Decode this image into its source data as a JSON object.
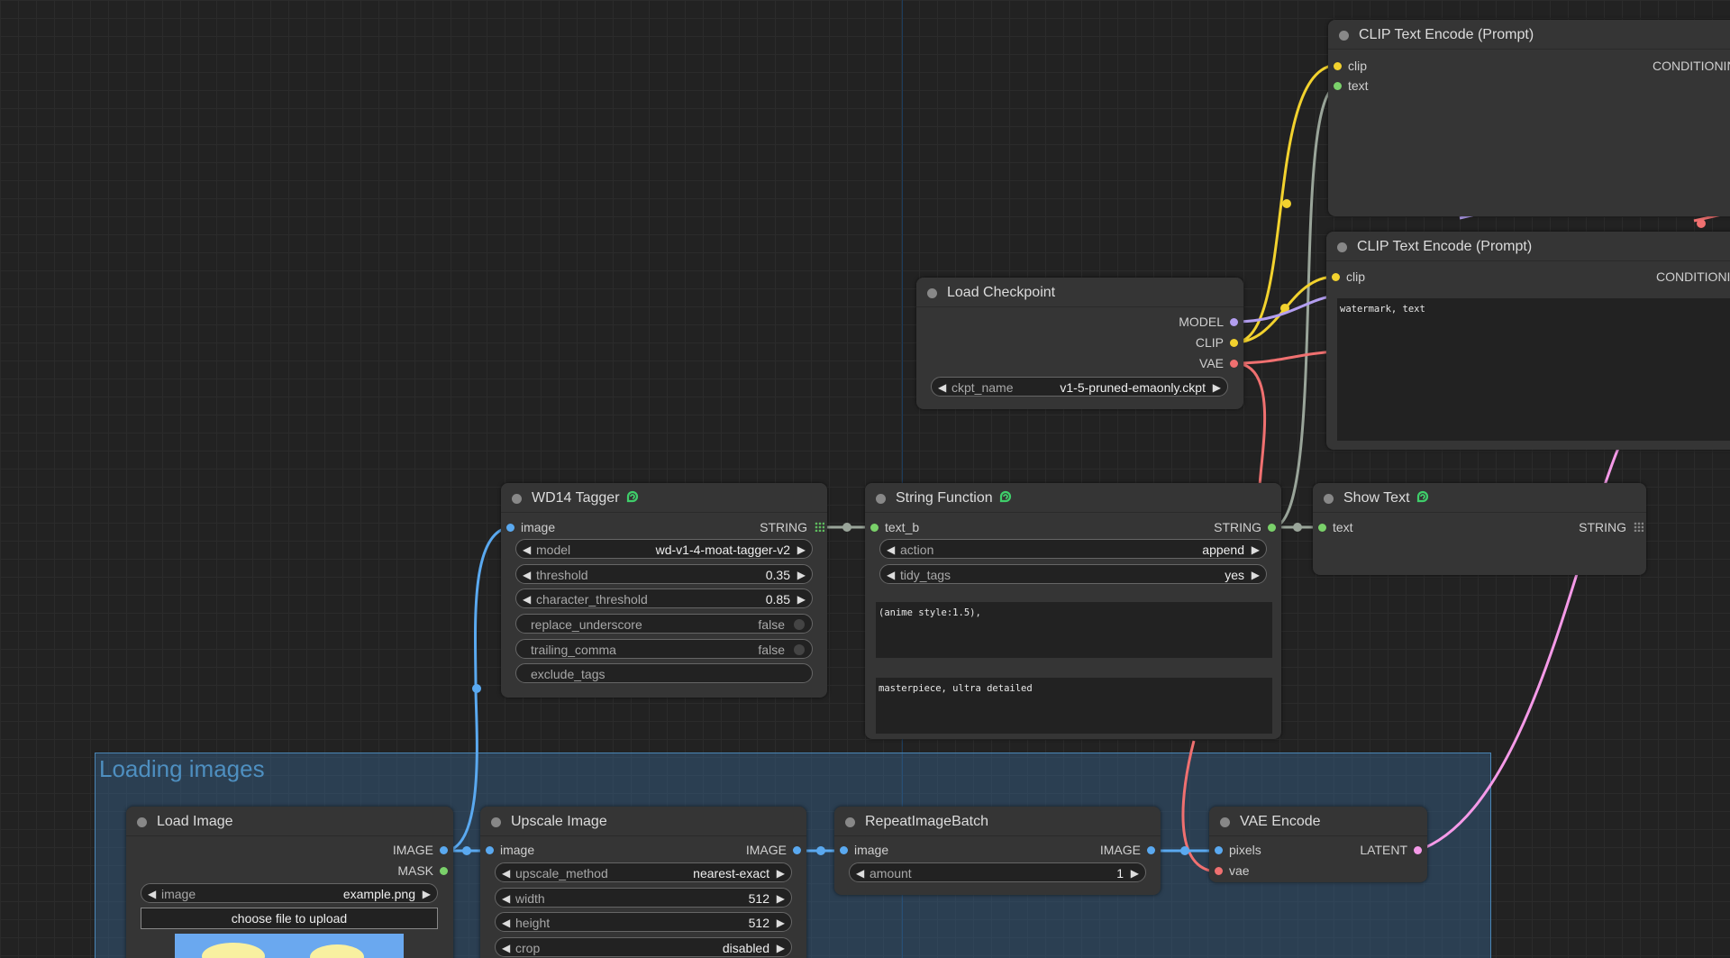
{
  "colors": {
    "image": "#5aa9f0",
    "string": "#7ad16a",
    "clip": "#f2d22e",
    "model": "#b39ef0",
    "vae": "#f07070",
    "latent": "#f59ae8",
    "conditioning": "#f0a060",
    "grey_link": "#9aa59a",
    "group": "#4e8fc0"
  },
  "group": {
    "title": "Loading images"
  },
  "nodes": {
    "clip1": {
      "title": "CLIP Text Encode (Prompt)",
      "in_clip": "clip",
      "in_text": "text",
      "out": "CONDITIONING"
    },
    "clip2": {
      "title": "CLIP Text Encode (Prompt)",
      "in_clip": "clip",
      "out": "CONDITIONING",
      "text": "watermark, text"
    },
    "checkpoint": {
      "title": "Load Checkpoint",
      "out_model": "MODEL",
      "out_clip": "CLIP",
      "out_vae": "VAE",
      "ckpt_label": "ckpt_name",
      "ckpt_value": "v1-5-pruned-emaonly.ckpt"
    },
    "wd14": {
      "title": "WD14 Tagger",
      "in_image": "image",
      "out": "STRING",
      "model_label": "model",
      "model_value": "wd-v1-4-moat-tagger-v2",
      "threshold_label": "threshold",
      "threshold_value": "0.35",
      "char_label": "character_threshold",
      "char_value": "0.85",
      "replace_label": "replace_underscore",
      "replace_value": "false",
      "trailing_label": "trailing_comma",
      "trailing_value": "false",
      "exclude_label": "exclude_tags"
    },
    "strfn": {
      "title": "String Function",
      "in_text_b": "text_b",
      "out": "STRING",
      "action_label": "action",
      "action_value": "append",
      "tidy_label": "tidy_tags",
      "tidy_value": "yes",
      "text_a": "(anime style:1.5),",
      "text_c": "masterpiece, ultra detailed"
    },
    "showtext": {
      "title": "Show Text",
      "in_text": "text",
      "out": "STRING"
    },
    "loadimage": {
      "title": "Load Image",
      "out_image": "IMAGE",
      "out_mask": "MASK",
      "image_label": "image",
      "image_value": "example.png",
      "upload_label": "choose file to upload"
    },
    "upscale": {
      "title": "Upscale Image",
      "in_image": "image",
      "out": "IMAGE",
      "method_label": "upscale_method",
      "method_value": "nearest-exact",
      "width_label": "width",
      "width_value": "512",
      "height_label": "height",
      "height_value": "512",
      "crop_label": "crop",
      "crop_value": "disabled"
    },
    "repeat": {
      "title": "RepeatImageBatch",
      "in_image": "image",
      "out": "IMAGE",
      "amount_label": "amount",
      "amount_value": "1"
    },
    "vaeenc": {
      "title": "VAE Encode",
      "in_pixels": "pixels",
      "in_vae": "vae",
      "out": "LATENT"
    }
  }
}
